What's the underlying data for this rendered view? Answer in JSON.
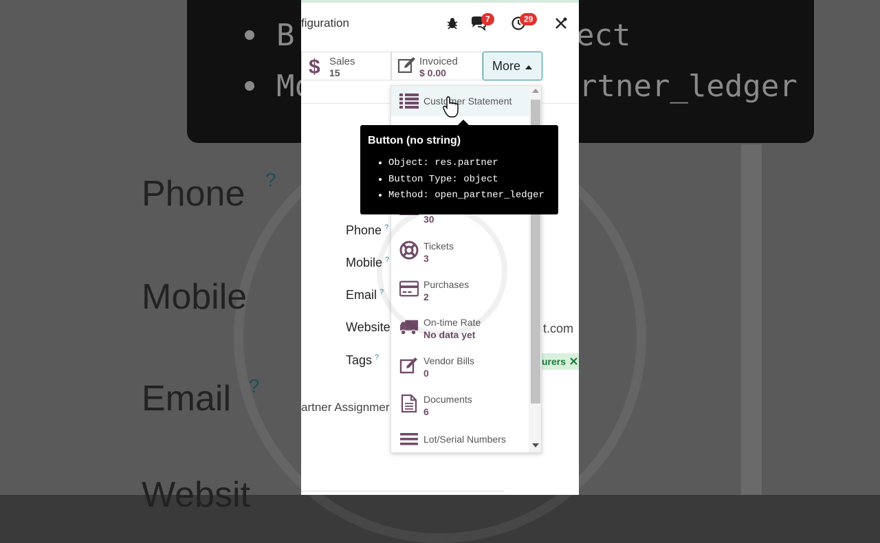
{
  "background": {
    "code_lines": [
      "B",
      "ect",
      "Mo",
      "rtner_ledger"
    ],
    "labels": [
      "Phone",
      "Mobile",
      "Email",
      "Websit"
    ]
  },
  "header": {
    "breadcrumb": "figuration",
    "messages_badge": "7",
    "activities_badge": "29"
  },
  "stats": {
    "sales": {
      "label": "Sales",
      "value": "15"
    },
    "invoiced": {
      "label": "Invoiced",
      "value": "$ 0.00"
    },
    "more_label": "More"
  },
  "form": {
    "fields": [
      {
        "label": "Phone",
        "help": "?"
      },
      {
        "label": "Mobile",
        "help": "?"
      },
      {
        "label": "Email",
        "help": "?"
      },
      {
        "label": "Website",
        "help": "?"
      },
      {
        "label": "Tags",
        "help": "?"
      }
    ],
    "website_tail": "t.com",
    "tag_text": "urers",
    "partner_tab": "artner Assignmer"
  },
  "dropdown": {
    "items": [
      {
        "label": "Customer Statement",
        "value": "",
        "icon": "list-icon"
      },
      {
        "label": "",
        "value": "30",
        "icon": "card-icon"
      },
      {
        "label": "Tickets",
        "value": "3",
        "icon": "lifebuoy-icon"
      },
      {
        "label": "Purchases",
        "value": "2",
        "icon": "credit-card-icon"
      },
      {
        "label": "On-time Rate",
        "value": "No data yet",
        "icon": "truck-icon"
      },
      {
        "label": "Vendor Bills",
        "value": "0",
        "icon": "edit-icon"
      },
      {
        "label": "Documents",
        "value": "6",
        "icon": "document-icon"
      },
      {
        "label": "Lot/Serial Numbers",
        "value": "",
        "icon": "bars-icon"
      }
    ]
  },
  "tooltip": {
    "title": "Button (no string)",
    "rows": [
      {
        "key": "Object:",
        "value": "res.partner"
      },
      {
        "key": "Button Type:",
        "value": "object"
      },
      {
        "key": "Method:",
        "value": "open_partner_ledger"
      }
    ]
  },
  "colors": {
    "accent": "#2a8f99",
    "brand": "#714b67",
    "badge": "#e0342f"
  }
}
